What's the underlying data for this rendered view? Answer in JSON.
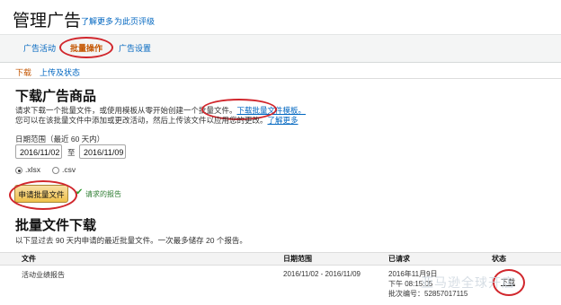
{
  "header": {
    "title": "管理广告",
    "links": [
      "了解更多",
      "为此页评级"
    ]
  },
  "tabs": [
    {
      "label": "广告活动",
      "active": false
    },
    {
      "label": "批量操作",
      "active": true
    },
    {
      "label": "广告设置",
      "active": false
    }
  ],
  "subtabs": [
    {
      "label": "下载",
      "active": true
    },
    {
      "label": "上传及状态",
      "active": false
    }
  ],
  "download": {
    "title": "下载广告商品",
    "desc_line1": "请求下载一个批量文件，或使用模板从零开始创建一个批量文件。",
    "template_link": "下载批量文件模板。",
    "desc_line2": "您可以在该批量文件中添加或更改活动，然后上传该文件以应用您的更改。",
    "learn_more": "了解更多",
    "date_range_label": "日期范围（最近 60 天内）",
    "date_from": "2016/11/02",
    "date_sep": "至",
    "date_to": "2016/11/09",
    "format_options": [
      {
        "label": ".xlsx",
        "selected": true
      },
      {
        "label": ".csv",
        "selected": false
      }
    ],
    "request_button": "申请批量文件",
    "request_status": "请求的报告"
  },
  "bulk_files": {
    "title": "批量文件下载",
    "desc": "以下显过去 90 天内申请的最近批量文件。一次最多储存 20 个报告。",
    "columns": [
      "文件",
      "日期范围",
      "已请求",
      "状态"
    ],
    "rows": [
      {
        "file": "活动业绩报告",
        "date_range": "2016/11/02 - 2016/11/09",
        "requested_line1": "2016年11月9日",
        "requested_line2": "下午 08:15:05",
        "batch_label": "批次编号：",
        "batch_id": "52857017115",
        "status": "下载"
      }
    ]
  },
  "watermark": "亚马逊全球开店",
  "colors": {
    "link": "#0066c0",
    "active_tab": "#c45500",
    "annotation_circle": "#d1262c",
    "button_bg": "#f0c14b",
    "success": "#2e9b2e"
  }
}
